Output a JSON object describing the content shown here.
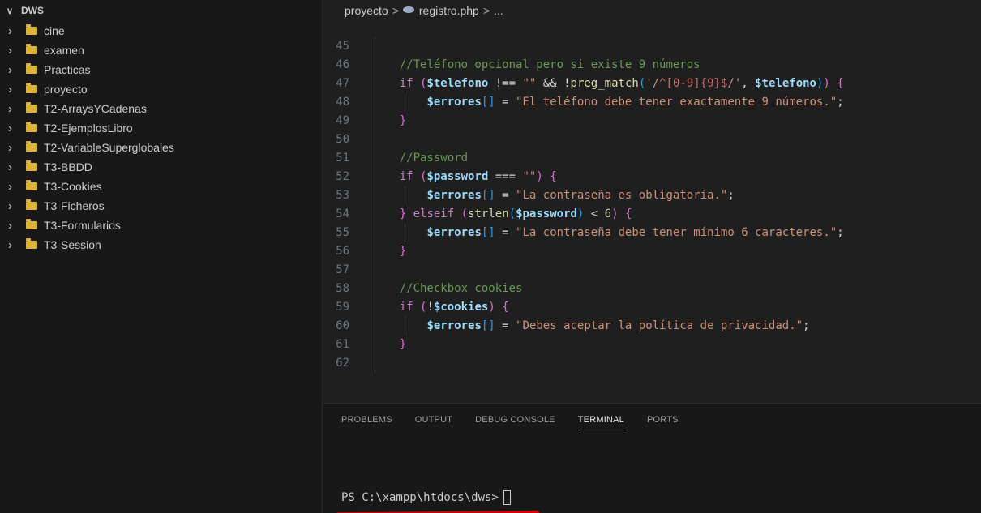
{
  "explorer": {
    "root_label": "DWS",
    "root_chevron": "chevron-down-icon",
    "folders": [
      {
        "name": "cine"
      },
      {
        "name": "examen"
      },
      {
        "name": "Practicas"
      },
      {
        "name": "proyecto"
      },
      {
        "name": "T2-ArraysYCadenas"
      },
      {
        "name": "T2-EjemplosLibro"
      },
      {
        "name": "T2-VariableSuperglobales"
      },
      {
        "name": "T3-BBDD"
      },
      {
        "name": "T3-Cookies"
      },
      {
        "name": "T3-Ficheros"
      },
      {
        "name": "T3-Formularios"
      },
      {
        "name": "T3-Session"
      }
    ],
    "folder_icon_color": "#dcb23e"
  },
  "breadcrumb": {
    "folder": "proyecto",
    "separator": ">",
    "file": "registro.php",
    "tail": "..."
  },
  "code": {
    "lines": [
      {
        "n": "45",
        "text": ""
      },
      {
        "n": "46",
        "text": "//Teléfono opcional pero si existe 9 números"
      },
      {
        "n": "47",
        "text": "if ($telefono !== \"\" && !preg_match('/^[0-9]{9}$/', $telefono)) {"
      },
      {
        "n": "48",
        "text": "$errores[] = \"El teléfono debe tener exactamente 9 números.\";"
      },
      {
        "n": "49",
        "text": "}"
      },
      {
        "n": "50",
        "text": ""
      },
      {
        "n": "51",
        "text": "//Password"
      },
      {
        "n": "52",
        "text": "if ($password === \"\") {"
      },
      {
        "n": "53",
        "text": "$errores[] = \"La contraseña es obligatoria.\";"
      },
      {
        "n": "54",
        "text": "} elseif (strlen($password) < 6) {"
      },
      {
        "n": "55",
        "text": "$errores[] = \"La contraseña debe tener mínimo 6 caracteres.\";"
      },
      {
        "n": "56",
        "text": "}"
      },
      {
        "n": "57",
        "text": ""
      },
      {
        "n": "58",
        "text": "//Checkbox cookies"
      },
      {
        "n": "59",
        "text": "if (!$cookies) {"
      },
      {
        "n": "60",
        "text": "$errores[] = \"Debes aceptar la política de privacidad.\";"
      },
      {
        "n": "61",
        "text": "}"
      },
      {
        "n": "62",
        "text": ""
      }
    ]
  },
  "panel": {
    "tabs": [
      {
        "label": "PROBLEMS",
        "active": false
      },
      {
        "label": "OUTPUT",
        "active": false
      },
      {
        "label": "DEBUG CONSOLE",
        "active": false
      },
      {
        "label": "TERMINAL",
        "active": true
      },
      {
        "label": "PORTS",
        "active": false
      }
    ],
    "prompt": "PS C:\\xampp\\htdocs\\dws>",
    "underline_color": "#d00000"
  }
}
